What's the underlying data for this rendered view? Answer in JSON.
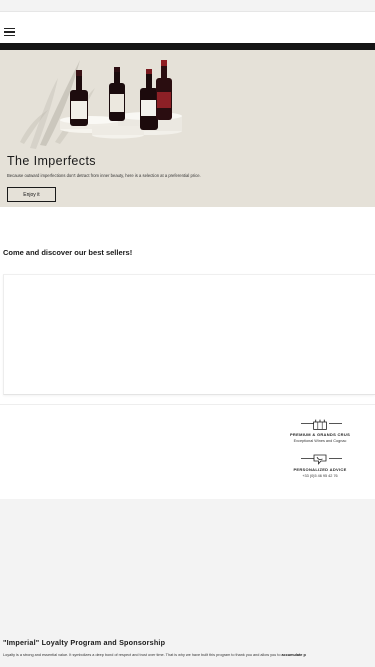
{
  "header": {
    "menu_icon": "hamburger-menu-icon"
  },
  "hero": {
    "title": "The Imperfects",
    "subtitle": "Because outward imperfections don't detract from inner beauty, here is a selection at a preferential price.",
    "button_label": "Enjoy it"
  },
  "bestsellers": {
    "heading": "Come and discover our best sellers!"
  },
  "features": [
    {
      "icon": "wine-crates-icon",
      "title": "PREMIUM & GRANDS CRUS",
      "subtitle": "Exceptional Wines and Cognac"
    },
    {
      "icon": "phone-chat-icon",
      "title": "PERSONALIZED ADVICE",
      "subtitle": "+33 (0)5 46 95 42 76"
    }
  ],
  "loyalty": {
    "title": "\"Imperial\" Loyalty Program and Sponsorship",
    "text": "Loyalty is a strong and essential value. It symbolizes a deep bond of respect and trust over time. That is why we have built this program to thank you and allow you to",
    "text_bold": "accumulate p"
  },
  "colors": {
    "hero_bg": "#e5e1d8",
    "page_bg": "#f3f3f3",
    "dark_bar": "#151515"
  }
}
